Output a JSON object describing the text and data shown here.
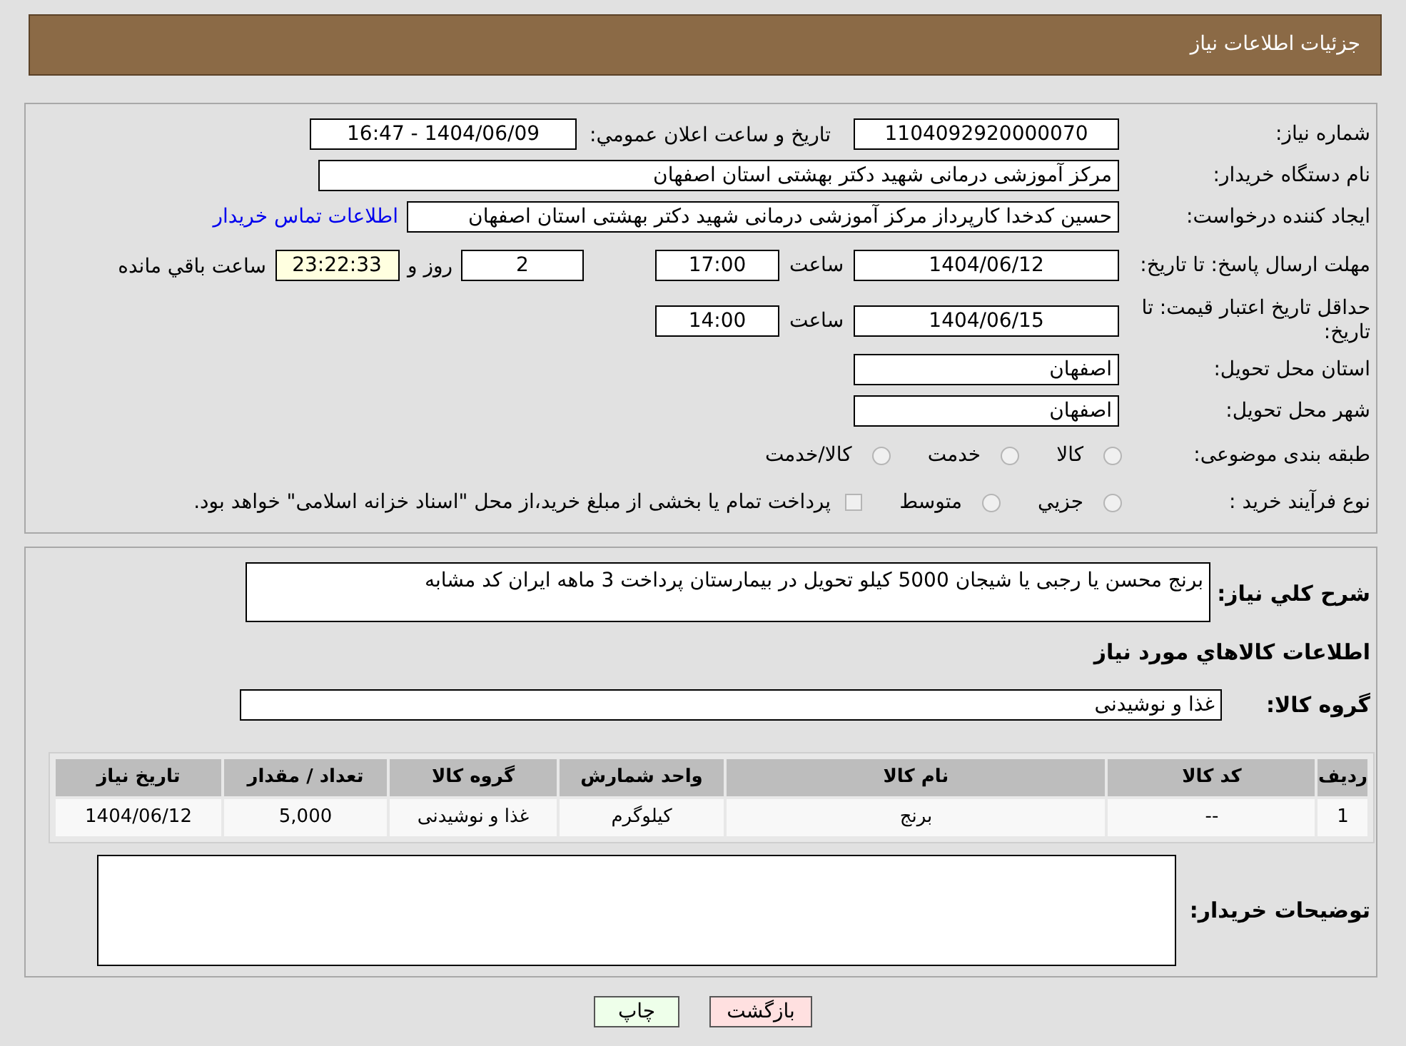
{
  "header": {
    "title": "جزئیات اطلاعات نیاز"
  },
  "need_number": {
    "label": "شماره نیاز:",
    "value": "1104092920000070"
  },
  "announce": {
    "label": "تاریخ و ساعت اعلان عمومي:",
    "value": "1404/06/09 - 16:47"
  },
  "buyer_org": {
    "label": "نام دستگاه خریدار:",
    "value": "مرکز آموزشی درمانی شهید دکتر بهشتی استان اصفهان"
  },
  "requester": {
    "label": "ایجاد کننده درخواست:",
    "value": "حسین کدخدا کارپرداز مرکز آموزشی درمانی شهید دکتر بهشتی استان اصفهان",
    "link": "اطلاعات تماس خریدار"
  },
  "deadline": {
    "label": "مهلت ارسال پاسخ: تا تاریخ:",
    "date": "1404/06/12",
    "time_label": "ساعت",
    "time": "17:00",
    "days": "2",
    "days_label": "روز و",
    "remaining": "23:22:33",
    "remaining_label": "ساعت باقي مانده"
  },
  "validity": {
    "label": "حداقل تاریخ اعتبار قیمت: تا تاریخ:",
    "date": "1404/06/15",
    "time_label": "ساعت",
    "time": "14:00"
  },
  "province": {
    "label": "استان محل تحویل:",
    "value": "اصفهان"
  },
  "city": {
    "label": "شهر محل تحویل:",
    "value": "اصفهان"
  },
  "category": {
    "label": "طبقه بندی موضوعی:",
    "options": [
      {
        "label": "کالا",
        "selected": false
      },
      {
        "label": "خدمت",
        "selected": false
      },
      {
        "label": "کالا/خدمت",
        "selected": false
      }
    ]
  },
  "process": {
    "label": "نوع فرآیند خرید :",
    "options": [
      {
        "label": "جزيي",
        "selected": false
      },
      {
        "label": "متوسط",
        "selected": false
      }
    ],
    "payment": {
      "label": "پرداخت تمام یا بخشی از مبلغ خرید،از محل \"اسناد خزانه اسلامی\" خواهد بود.",
      "checked": false
    }
  },
  "description": {
    "label": "شرح كلي نياز:",
    "value": "برنج محسن یا رجبی یا شیجان 5000 کیلو تحویل در بیمارستان پرداخت 3 ماهه ایران کد مشابه"
  },
  "goods_heading": "اطلاعات كالاهاي مورد نياز",
  "goods_group": {
    "label": "گروه کالا:",
    "value": "غذا و نوشیدنی"
  },
  "table": {
    "columns": [
      "ردیف",
      "کد کالا",
      "نام کالا",
      "واحد شمارش",
      "گروه کالا",
      "تعداد / مقدار",
      "تاریخ نیاز"
    ],
    "rows": [
      [
        "1",
        "--",
        "برنج",
        "کیلوگرم",
        "غذا و نوشیدنی",
        "5,000",
        "1404/06/12"
      ]
    ]
  },
  "buyer_notes": {
    "label": "توضیحات خریدار:"
  },
  "buttons": [
    {
      "label": "بازگشت",
      "kind": "back"
    },
    {
      "label": "چاپ",
      "kind": "print"
    }
  ]
}
